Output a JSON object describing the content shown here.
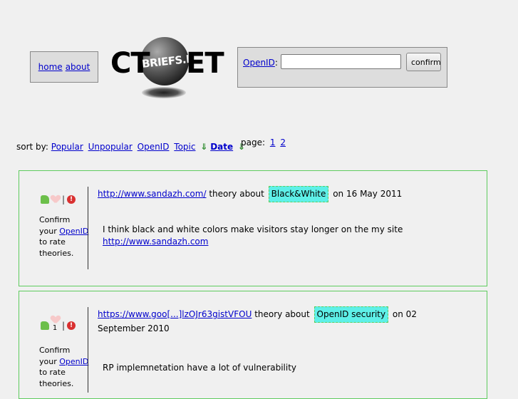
{
  "nav": {
    "home": "home",
    "about": "about"
  },
  "logo": {
    "left": "CT",
    "middle": "BRIEFS.N",
    "right": "ET"
  },
  "openid": {
    "label": "OpenID",
    "colon": ":",
    "input_value": "",
    "button": "confirm"
  },
  "sort": {
    "label": "sort by:",
    "options": [
      "Popular",
      "Unpopular",
      "OpenID",
      "Topic"
    ],
    "arrow": "⇓",
    "active": "Date"
  },
  "pages": {
    "label": "page:",
    "items": [
      "1",
      "2"
    ]
  },
  "theories": [
    {
      "url": "http://www.sandazh.com/",
      "about_text": "theory about",
      "topic": "Black&White",
      "date_text": "on 16 May 2011",
      "vote_count": "",
      "sep": "|",
      "confirm_pre": "Confirm your",
      "confirm_link": "OpenID",
      "confirm_post": "to rate theories.",
      "body_text": "I think black and white colors make visitors stay longer on the my site",
      "body_link": "http://www.sandazh.com"
    },
    {
      "url": "https://www.goo[...]lzOJr63gistVFOU",
      "about_text": "theory about",
      "topic": "OpenID security",
      "date_text": "on 02 September 2010",
      "vote_count": "1",
      "sep": "|",
      "confirm_pre": "Confirm your",
      "confirm_link": "OpenID",
      "confirm_post": "to rate theories.",
      "body_text": "RP implemnetation have a lot of vulnerability",
      "body_link": ""
    }
  ]
}
